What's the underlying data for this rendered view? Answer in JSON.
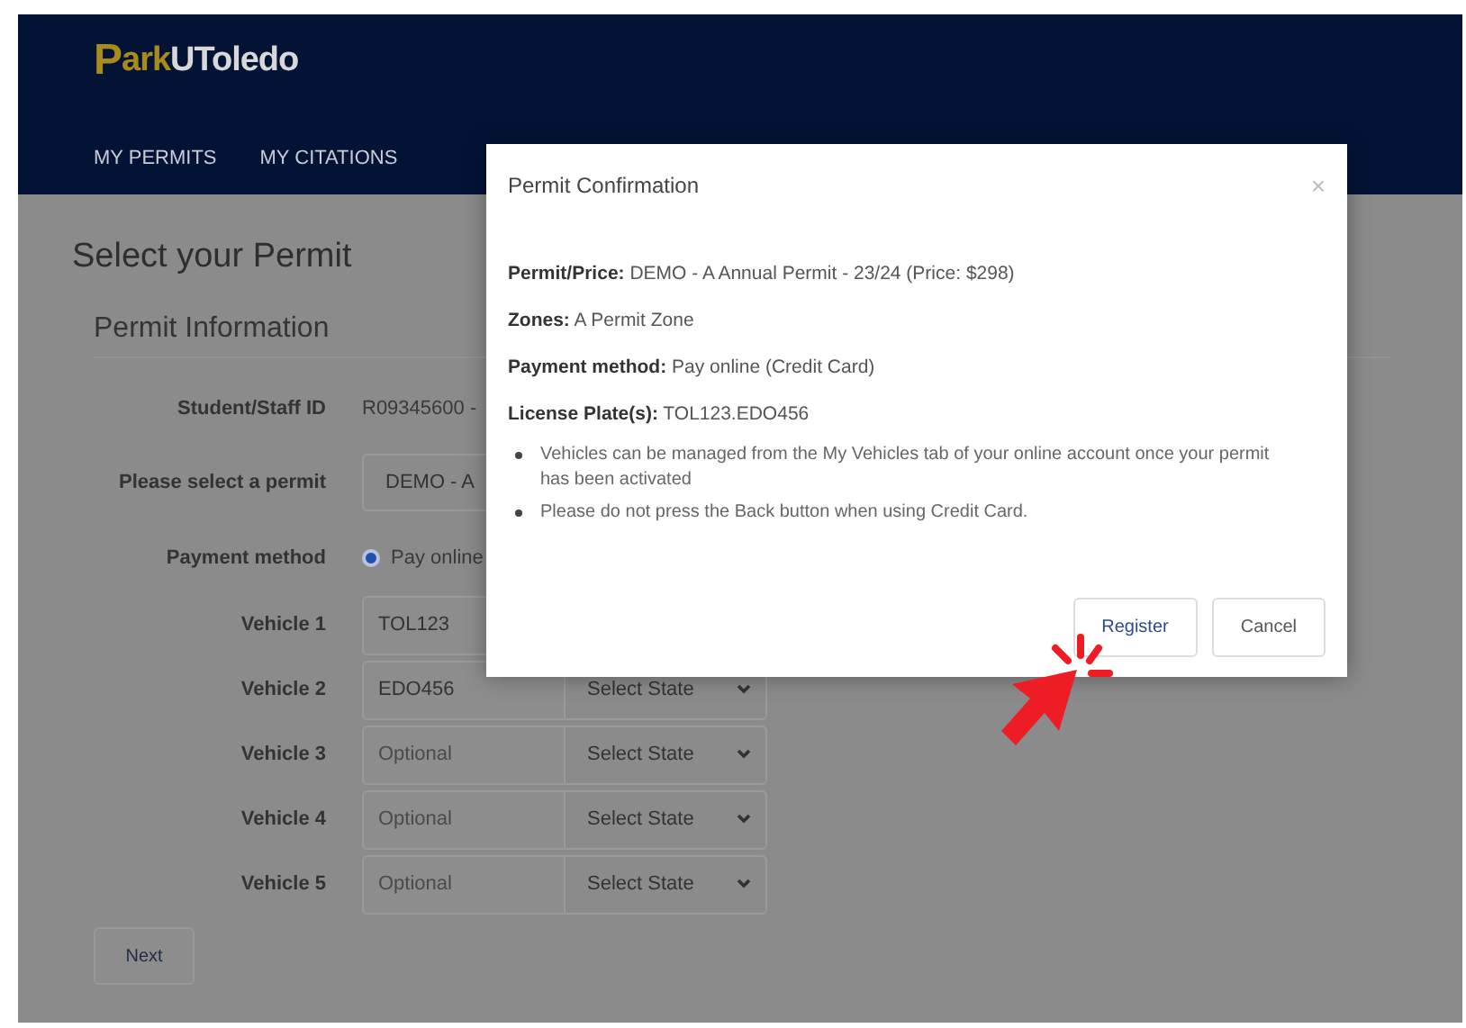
{
  "logo": {
    "initial": "P",
    "accent": "ark",
    "rest": "UToledo"
  },
  "nav": [
    {
      "label": "MY PERMITS"
    },
    {
      "label": "MY CITATIONS"
    }
  ],
  "page": {
    "title": "Select your Permit",
    "section": "Permit Information",
    "student_id": {
      "label": "Student/Staff ID",
      "value": "R09345600 -"
    },
    "permit": {
      "label": "Please select a permit",
      "value": "DEMO - A"
    },
    "payment": {
      "label": "Payment method",
      "option": "Pay online",
      "selected": true
    },
    "vehicles": [
      {
        "label": "Vehicle 1",
        "plate": "TOL123"
      },
      {
        "label": "Vehicle 2",
        "plate": "EDO456",
        "state": "Select State"
      },
      {
        "label": "Vehicle 3",
        "placeholder": "Optional",
        "state": "Select State"
      },
      {
        "label": "Vehicle 4",
        "placeholder": "Optional",
        "state": "Select State"
      },
      {
        "label": "Vehicle 5",
        "placeholder": "Optional",
        "state": "Select State"
      }
    ],
    "next_button": "Next"
  },
  "modal": {
    "title": "Permit Confirmation",
    "close": "×",
    "details": [
      "**Permit/Price:** DEMO - A Annual Permit - 23/24 (Price: $298)",
      "**Zones:** A Permit Zone",
      "**Payment method:** Pay online (Credit Card)",
      "**License Plate(s):** TOL123.EDO456"
    ],
    "notes": [
      "Vehicles can be managed from the My Vehicles tab of your online account once your permit has been activated",
      "Please do not press the Back button when using Credit Card."
    ],
    "buttons": [
      {
        "label": "Register",
        "kind": "primary"
      },
      {
        "label": "Cancel",
        "kind": "secondary"
      }
    ]
  }
}
